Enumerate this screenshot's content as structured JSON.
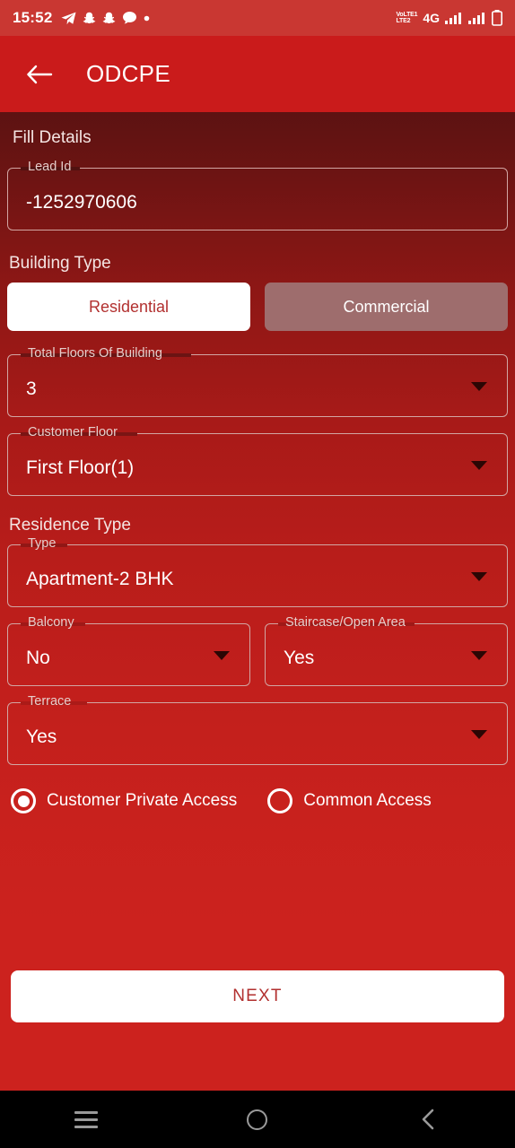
{
  "status_bar": {
    "time": "15:52",
    "left_icons": [
      "telegram-icon",
      "snapchat-icon",
      "snapchat-icon",
      "chat-bubble-icon",
      "dot-icon"
    ],
    "volte_top": "VoLTE1",
    "volte_bottom": "LTE2",
    "network": "4G",
    "signal_icons": [
      "signal-bars-icon",
      "signal-bars-icon"
    ],
    "battery": "battery-icon"
  },
  "app_bar": {
    "back_icon": "arrow-left-icon",
    "title": "ODCPE"
  },
  "form": {
    "fill_details_heading": "Fill Details",
    "lead_id": {
      "label": "Lead Id",
      "value": "-1252970606"
    },
    "building_type_heading": "Building Type",
    "building_type_options": [
      {
        "label": "Residential",
        "selected": true
      },
      {
        "label": "Commercial",
        "selected": false
      }
    ],
    "total_floors": {
      "label": "Total Floors Of Building",
      "value": "3"
    },
    "customer_floor": {
      "label": "Customer Floor",
      "value": "First Floor(1)"
    },
    "residence_type_heading": "Residence Type",
    "type": {
      "label": "Type",
      "value": "Apartment-2 BHK"
    },
    "balcony": {
      "label": "Balcony",
      "value": "No"
    },
    "staircase": {
      "label": "Staircase/Open Area",
      "value": "Yes"
    },
    "terrace": {
      "label": "Terrace",
      "value": "Yes"
    },
    "access_options": [
      {
        "label": "Customer Private Access",
        "selected": true
      },
      {
        "label": "Common Access",
        "selected": false
      }
    ],
    "next_label": "NEXT"
  },
  "nav_bar": {
    "recents": "recents-icon",
    "home": "home-icon",
    "back": "back-icon"
  },
  "colors": {
    "brand_red": "#ca1b1b",
    "status_bar": "#c93732",
    "accent_text": "#b2302f",
    "field_border": "#d2a6a3",
    "unselected_button": "#9e6d6d"
  }
}
